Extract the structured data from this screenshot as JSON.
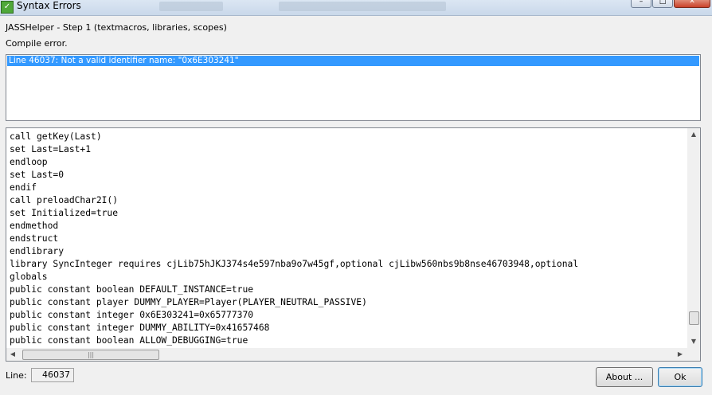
{
  "window": {
    "title": "Syntax Errors",
    "icon_glyph": "✓",
    "controls": {
      "minimize": "–",
      "maximize": "□",
      "close": "✕"
    }
  },
  "step_label": "JASSHelper - Step 1 (textmacros, libraries, scopes)",
  "compile_label": "Compile error.",
  "errors": [
    "Line 46037: Not a valid identifier name: \"0x6E303241\""
  ],
  "code_lines": [
    "call getKey(Last)",
    "set Last=Last+1",
    "endloop",
    "set Last=0",
    "endif",
    "call preloadChar2I()",
    "set Initialized=true",
    "endmethod",
    "endstruct",
    "endlibrary",
    "library SyncInteger requires cjLib75hJKJ374s4e597nba9o7w45gf,optional cjLibw560nbs9b8nse46703948,optional ",
    "globals",
    "public constant boolean DEFAULT_INSTANCE=true",
    "public constant player DUMMY_PLAYER=Player(PLAYER_NEUTRAL_PASSIVE)",
    "public constant integer 0x6E303241=0x65777370",
    "public constant integer DUMMY_ABILITY=0x41657468",
    "public constant boolean ALLOW_DEBUGGING=true"
  ],
  "scroll": {
    "up": "▲",
    "down": "▼",
    "left": "◀",
    "right": "▶",
    "grip": "|||"
  },
  "line_label": "Line:",
  "line_value": "46037",
  "buttons": {
    "about": "About ...",
    "ok": "Ok"
  }
}
